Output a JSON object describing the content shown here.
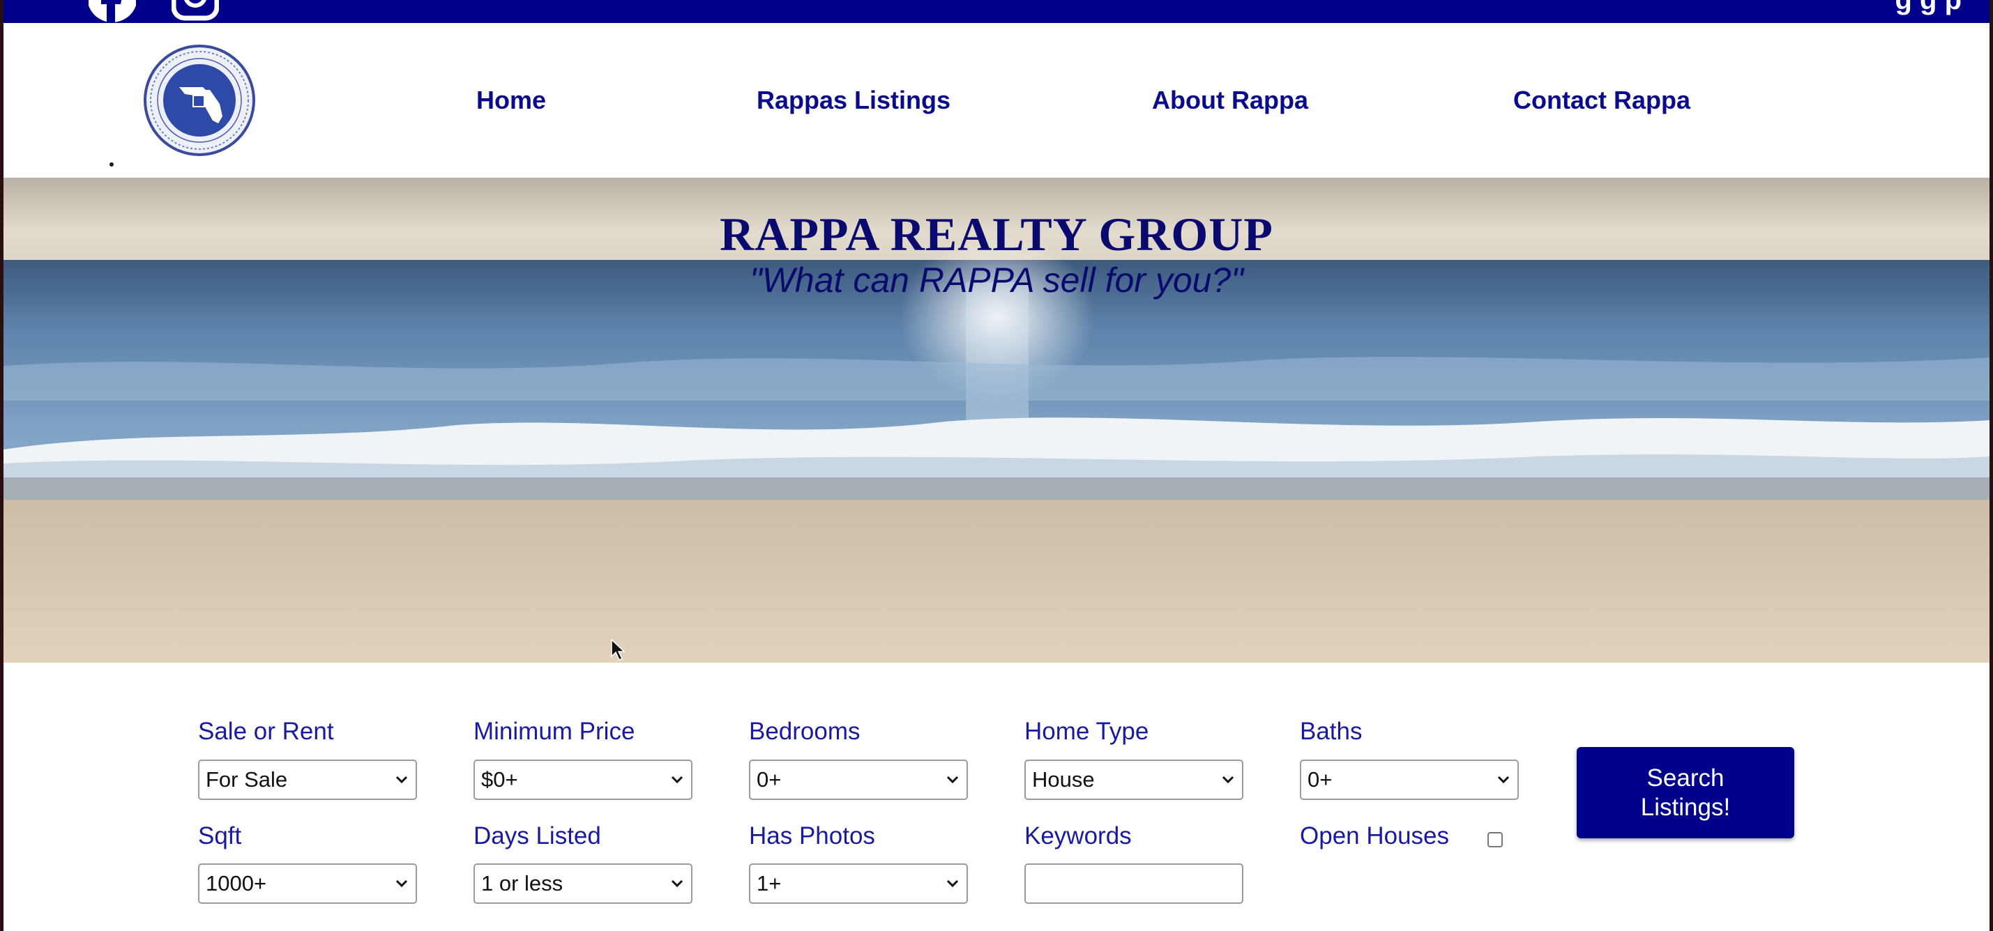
{
  "nav": {
    "home": "Home",
    "listings": "Rappas Listings",
    "about": "About Rappa",
    "contact": "Contact Rappa"
  },
  "topbar": {
    "social_icons": [
      "facebook-icon",
      "instagram-icon"
    ],
    "right_text": "g   g p"
  },
  "hero": {
    "title": "RAPPA REALTY GROUP",
    "tagline": "\"What can RAPPA sell for you?\""
  },
  "search": {
    "sale_or_rent": {
      "label": "Sale or Rent",
      "value": "For Sale"
    },
    "min_price": {
      "label": "Minimum Price",
      "value": "$0+"
    },
    "bedrooms": {
      "label": "Bedrooms",
      "value": "0+"
    },
    "home_type": {
      "label": "Home Type",
      "value": "House"
    },
    "baths": {
      "label": "Baths",
      "value": "0+"
    },
    "sqft": {
      "label": "Sqft",
      "value": "1000+"
    },
    "days_listed": {
      "label": "Days Listed",
      "value": "1 or less"
    },
    "has_photos": {
      "label": "Has Photos",
      "value": "1+"
    },
    "keywords": {
      "label": "Keywords",
      "value": ""
    },
    "open_houses": {
      "label": "Open Houses",
      "checked": false
    },
    "button_label": "Search Listings!"
  },
  "colors": {
    "brand_navy": "#00008b",
    "label_blue": "#1a1aa0",
    "title_navy": "#0a0a6e"
  }
}
